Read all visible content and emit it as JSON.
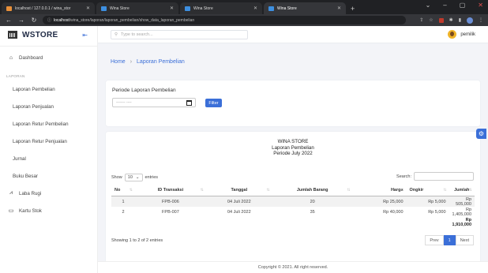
{
  "browser": {
    "tabs": [
      {
        "title": "localhost / 127.0.0.1 / wina_stor"
      },
      {
        "title": "Wina Store"
      },
      {
        "title": "Wina Store"
      },
      {
        "title": "Wina Store"
      }
    ],
    "new_tab": "+",
    "url_host": "localhost",
    "url_path": "/wina_store/laporan/laporan_pembelian/show_data_laporan_pembelian",
    "icons": [
      "back-icon",
      "forward-icon",
      "reload-icon",
      "info-icon",
      "share-icon",
      "star-icon",
      "extension-icon",
      "puzzle-icon",
      "sidepanel-icon",
      "profile-icon",
      "menu-icon"
    ]
  },
  "sidebar": {
    "brand": "WSTORE",
    "dashboard": "Dashboard",
    "section": "LAPORAN",
    "items": [
      {
        "label": "Laporan Pembelian"
      },
      {
        "label": "Laporan Penjualan"
      },
      {
        "label": "Laporan Retur Pembelian"
      },
      {
        "label": "Laporan Retur Penjualan"
      },
      {
        "label": "Jurnal"
      },
      {
        "label": "Buku Besar"
      }
    ],
    "laba_rugi": "Laba Rugi",
    "kartu_stok": "Kartu Stok"
  },
  "topbar": {
    "search_placeholder": "Type to search...",
    "username": "pemilik"
  },
  "breadcrumb": {
    "home": "Home",
    "current": "Laporan Pembelian"
  },
  "filter": {
    "title": "Periode Laporan Pembelian",
    "date_placeholder": "------- ----",
    "button": "Filter"
  },
  "report": {
    "store": "WINA STORE",
    "name": "Laporan Pembelian",
    "period": "Periode July 2022",
    "show_label": "Show",
    "show_value": "10",
    "entries_label": "entries",
    "search_label": "Search:",
    "columns": [
      "No",
      "ID Transaksi",
      "Tanggal",
      "Jumlah Barang",
      "Harga",
      "Ongkir",
      "Jumlah"
    ],
    "rows": [
      {
        "no": "1",
        "id": "FPB-006",
        "tanggal": "04 Juli 2022",
        "jumlah_barang": "20",
        "harga": "Rp 25,000",
        "ongkir": "Rp 5,000",
        "jumlah": "Rp 505,000"
      },
      {
        "no": "2",
        "id": "FPB-007",
        "tanggal": "04 Juli 2022",
        "jumlah_barang": "35",
        "harga": "Rp 40,000",
        "ongkir": "Rp 5,000",
        "jumlah": "Rp 1,405,000"
      }
    ],
    "total": "Rp 1,910,000",
    "info": "Showing 1 to 2 of 2 entries",
    "prev": "Prev",
    "page": "1",
    "next": "Next"
  },
  "footer": "Copyright © 2021. All right reserved."
}
